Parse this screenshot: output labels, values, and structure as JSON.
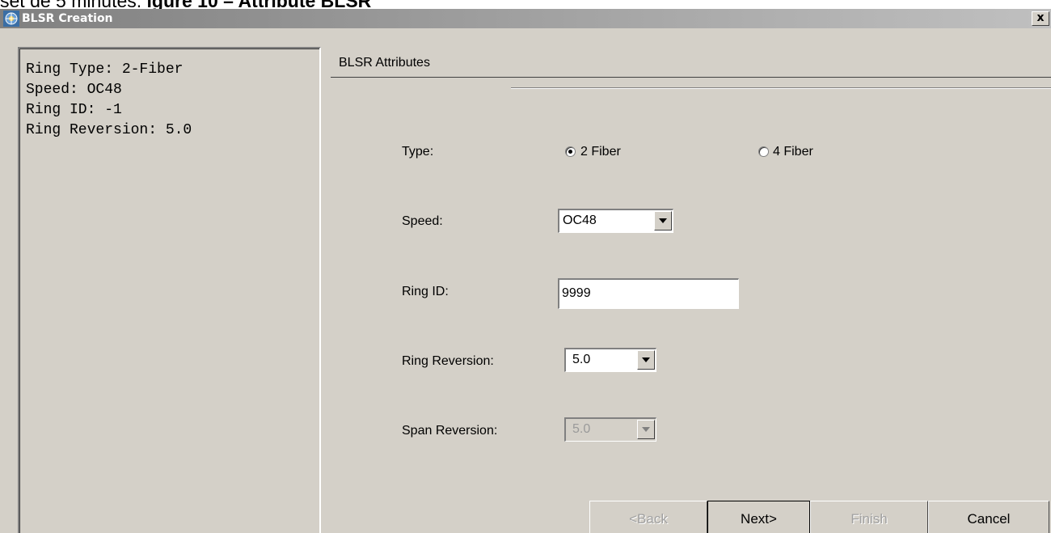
{
  "caption": {
    "prefix": "set de 5 minutes. ",
    "bold": "igure 10 – Attribute BLSR"
  },
  "window": {
    "title": "BLSR Creation",
    "close_label": "x"
  },
  "summary": {
    "lines": [
      "Ring Type: 2-Fiber",
      "Speed: OC48",
      "Ring ID: -1",
      "Ring Reversion: 5.0"
    ]
  },
  "attributes": {
    "section_title": "BLSR Attributes",
    "type": {
      "label": "Type:",
      "options": [
        "2 Fiber",
        "4 Fiber"
      ],
      "selected": "2 Fiber"
    },
    "speed": {
      "label": "Speed:",
      "value": "OC48"
    },
    "ring_id": {
      "label": "Ring ID:",
      "value": "9999"
    },
    "ring_reversion": {
      "label": "Ring Reversion:",
      "value": "5.0"
    },
    "span_reversion": {
      "label": "Span Reversion:",
      "value": "5.0",
      "enabled": false
    }
  },
  "buttons": {
    "back": "<Back",
    "next": "Next>",
    "finish": "Finish",
    "cancel": "Cancel"
  },
  "colors": {
    "dialog_bg": "#d4d0c8",
    "titlebar": "#808080"
  }
}
